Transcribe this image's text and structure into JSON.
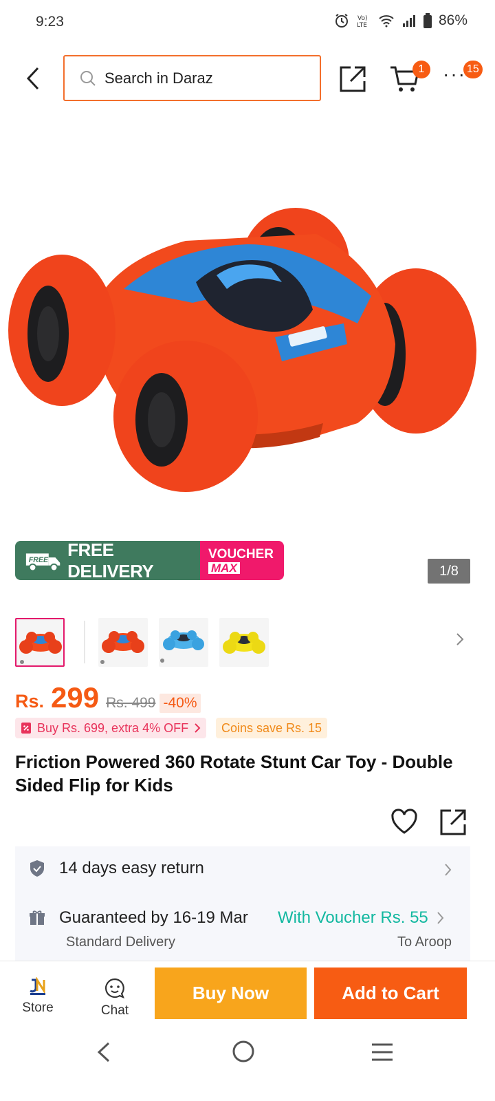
{
  "status_bar": {
    "time": "9:23",
    "battery": "86%",
    "icons": [
      "alarm-icon",
      "volte-icon",
      "wifi-icon",
      "signal-icon",
      "battery-icon"
    ]
  },
  "header": {
    "search_placeholder": "Search in Daraz",
    "cart_count": "1",
    "more_count": "15",
    "icons": [
      "back-icon",
      "search-icon",
      "share-icon",
      "cart-icon",
      "more-icon"
    ]
  },
  "gallery": {
    "counter": "1/8",
    "promo_free_delivery_tag": "FREE",
    "promo_free_delivery": "FREE DELIVERY",
    "promo_voucher_line1": "VOUCHER",
    "promo_voucher_line2": "MAX",
    "thumbnails": [
      "red",
      "red",
      "blue",
      "yellow"
    ]
  },
  "price": {
    "currency": "Rs.",
    "current": "299",
    "original": "Rs. 499",
    "discount": "-40%"
  },
  "deals": {
    "bundle_offer": "Buy Rs. 699, extra 4% OFF",
    "coins": "Coins save Rs. 15"
  },
  "product": {
    "title": "Friction Powered 360 Rotate Stunt Car Toy - Double Sided Flip for Kids"
  },
  "info": {
    "returns": "14 days easy return",
    "delivery_guarantee": "Guaranteed by 16-19 Mar",
    "voucher_link": "With Voucher Rs. 55",
    "delivery_type": "Standard Delivery",
    "delivery_to": "To Aroop"
  },
  "bottom_bar": {
    "store_label": "Store",
    "chat_label": "Chat",
    "buy_now": "Buy Now",
    "add_to_cart": "Add to Cart"
  },
  "colors": {
    "brand_orange": "#f75c13",
    "buy_now_yellow": "#f8a51c",
    "voucher_teal": "#13b8a0",
    "free_delivery_green": "#3f7a5e",
    "voucher_pink": "#f0196b"
  }
}
